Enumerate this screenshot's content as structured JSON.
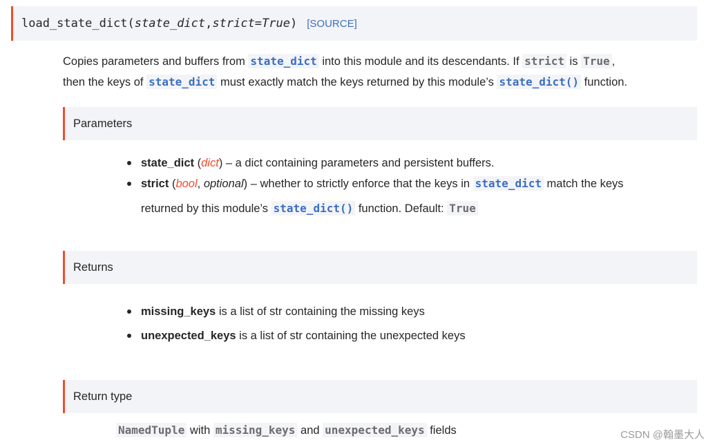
{
  "signature": {
    "name": "load_state_dict",
    "open": "(",
    "param1": "state_dict",
    "sep": ", ",
    "param2": "strict=True",
    "close": ")",
    "source_link": "[SOURCE]"
  },
  "description": {
    "t1": "Copies parameters and buffers from ",
    "c1": "state_dict",
    "t2": " into this module and its descendants. If ",
    "c2": "strict",
    "t3": " is ",
    "c3": "True",
    "t4": ",",
    "t5": "then the keys of ",
    "c4": "state_dict",
    "t6": " must exactly match the keys returned by this module’s ",
    "c5": "state_dict()",
    "t7": " function."
  },
  "parameters": {
    "heading": "Parameters",
    "items": [
      {
        "name": "state_dict",
        "open": " (",
        "type": "dict",
        "close": ")",
        "text": " – a dict containing parameters and persistent buffers."
      },
      {
        "name": "strict",
        "open": " (",
        "type": "bool",
        "comma": ", ",
        "optional": "optional",
        "close": ")",
        "text1": " – whether to strictly enforce that the keys in ",
        "code1": "state_dict",
        "text2": " match the keys",
        "text3": "returned by this module’s ",
        "code2": "state_dict()",
        "text4": " function. Default: ",
        "code3": "True"
      }
    ]
  },
  "returns": {
    "heading": "Returns",
    "items": [
      {
        "name": "missing_keys",
        "text": " is a list of str containing the missing keys"
      },
      {
        "name": "unexpected_keys",
        "text": " is a list of str containing the unexpected keys"
      }
    ]
  },
  "return_type": {
    "heading": "Return type",
    "c1": "NamedTuple",
    "t1": " with ",
    "c2": "missing_keys",
    "t2": " and ",
    "c3": "unexpected_keys",
    "t3": " fields"
  },
  "watermark": "CSDN @翰墨大人"
}
